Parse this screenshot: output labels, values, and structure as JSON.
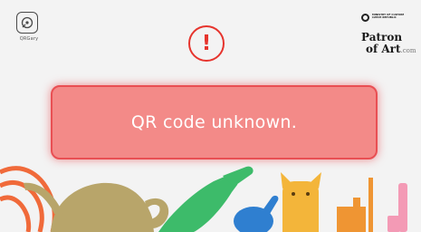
{
  "screen": {
    "message": "QR code unknown.",
    "alert_glyph": "!",
    "alert_color": "#e6342d",
    "message_fill": "#f38a88",
    "message_border": "#e94f53"
  },
  "branding": {
    "app_logo_text": "QRGary",
    "ministry_lines": [
      "MINISTRY OF CULTURE",
      "CZECH REPUBLIC"
    ],
    "patron_line1": "Patron",
    "patron_line2": "of Art",
    "patron_suffix": ".com"
  },
  "decorations": {
    "shapes": [
      "orange-rings",
      "olive-teapot",
      "green-vase",
      "blue-bottle",
      "yellow-cat",
      "orange-figure",
      "pink-stick"
    ]
  }
}
